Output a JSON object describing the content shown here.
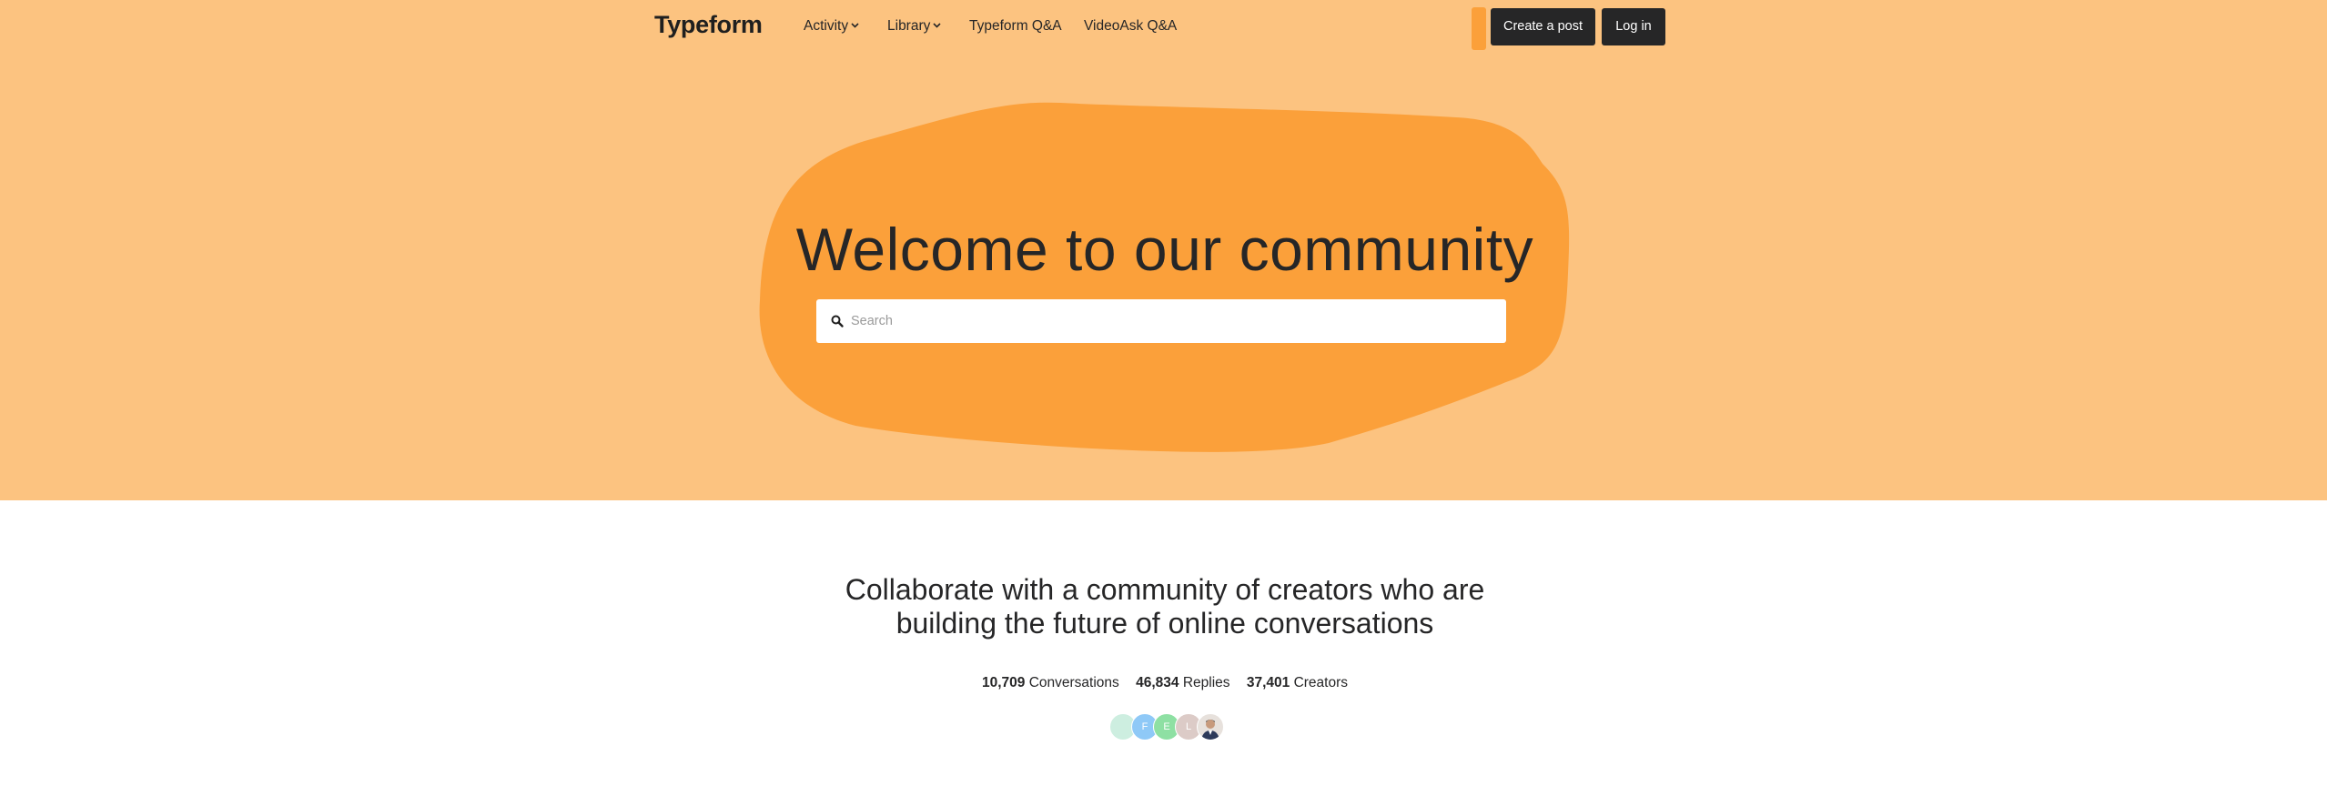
{
  "nav": {
    "brand": "Typeform",
    "items": [
      {
        "label": "Activity",
        "has_dropdown": true
      },
      {
        "label": "Library",
        "has_dropdown": true
      },
      {
        "label": "Typeform Q&A",
        "has_dropdown": false
      },
      {
        "label": "VideoAsk Q&A",
        "has_dropdown": false
      }
    ],
    "create_post_label": "Create a post",
    "login_label": "Log in"
  },
  "hero": {
    "title": "Welcome to our community",
    "search_placeholder": "Search",
    "search_value": "",
    "search_icon": "search-icon"
  },
  "community": {
    "tagline_line1": "Collaborate with a community of creators who are",
    "tagline_line2": "building the future of online conversations",
    "stats": [
      {
        "value": "10,709",
        "label": "Conversations"
      },
      {
        "value": "46,834",
        "label": "Replies"
      },
      {
        "value": "37,401",
        "label": "Creators"
      }
    ],
    "avatars": [
      {
        "initial": "",
        "color": "#cdeee0"
      },
      {
        "initial": "F",
        "color": "#8fc9f7"
      },
      {
        "initial": "E",
        "color": "#8ee0a3"
      },
      {
        "initial": "L",
        "color": "#dccbc7"
      },
      {
        "initial": "",
        "color": "#e7e1dc",
        "photo": true
      }
    ]
  },
  "colors": {
    "hero_bg": "#fcc380",
    "blob": "#fba03a",
    "dark_button": "#262627",
    "text": "#262627"
  }
}
